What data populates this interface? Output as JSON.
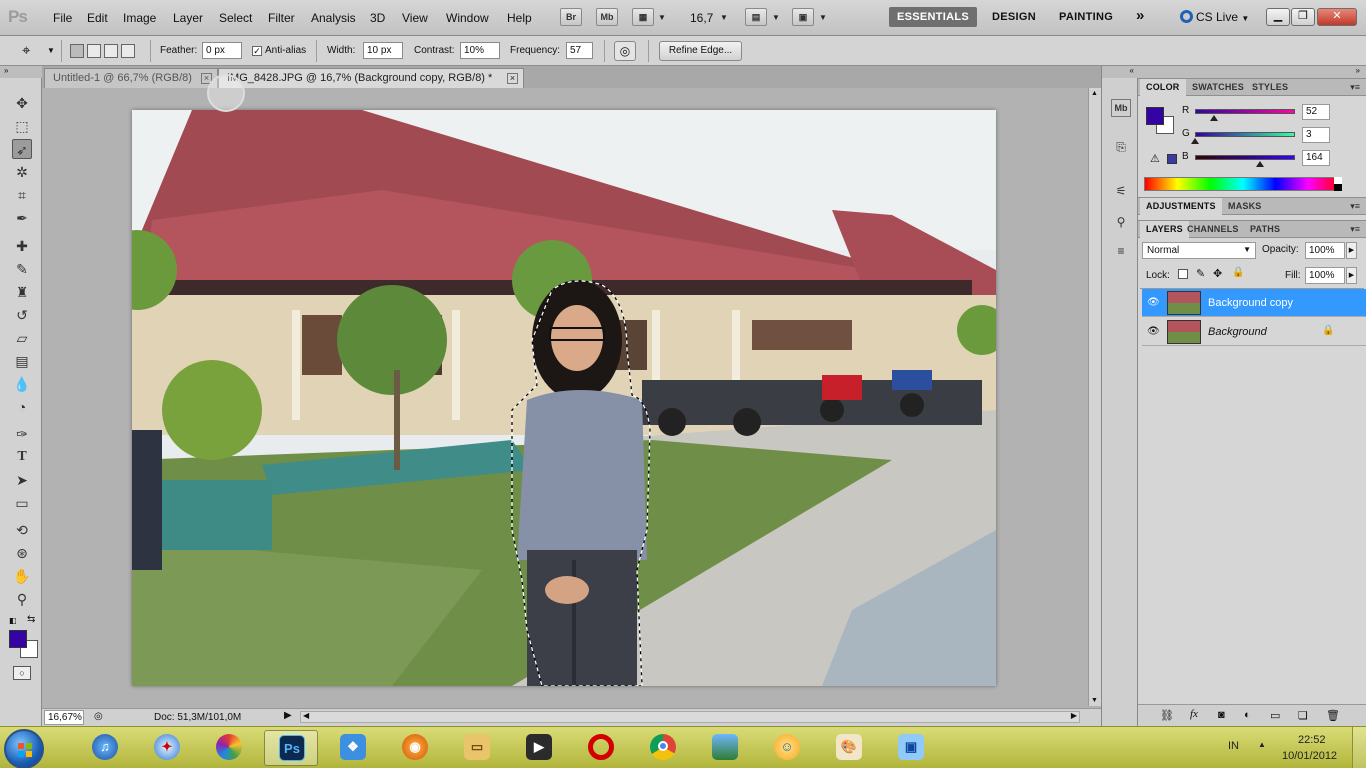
{
  "app": {
    "logo": "Ps",
    "menu": [
      "File",
      "Edit",
      "Image",
      "Layer",
      "Select",
      "Filter",
      "Analysis",
      "3D",
      "View",
      "Window",
      "Help"
    ],
    "bridge_buttons": [
      "Br",
      "Mb"
    ],
    "zoom": "16,7",
    "workspaces": [
      "ESSENTIALS",
      "DESIGN",
      "PAINTING"
    ],
    "more_workspaces": "»",
    "cslive": "CS Live"
  },
  "options": {
    "feather_label": "Feather:",
    "feather_value": "0 px",
    "antialias_label": "Anti-alias",
    "antialias_checked": "✓",
    "width_label": "Width:",
    "width_value": "10 px",
    "contrast_label": "Contrast:",
    "contrast_value": "10%",
    "frequency_label": "Frequency:",
    "frequency_value": "57",
    "refine_label": "Refine Edge..."
  },
  "tools": [
    "move-tool",
    "marquee-tool",
    "magnetic-lasso-tool",
    "quick-selection-tool",
    "crop-tool",
    "eyedropper-tool",
    "healing-brush-tool",
    "brush-tool",
    "clone-stamp-tool",
    "history-brush-tool",
    "eraser-tool",
    "gradient-tool",
    "blur-tool",
    "dodge-tool",
    "pen-tool",
    "type-tool",
    "path-selection-tool",
    "rectangle-tool",
    "3d-rotate-tool",
    "3d-orbit-tool",
    "hand-tool",
    "zoom-tool"
  ],
  "documents": {
    "tabs": [
      {
        "title": "Untitled-1 @ 66,7% (RGB/8)"
      },
      {
        "title": "IMG_8428.JPG @ 16,7% (Background copy, RGB/8) *"
      }
    ],
    "close_glyph": "×"
  },
  "status": {
    "zoom": "16,67%",
    "doc": "Doc: 51,3M/101,0M"
  },
  "color_panel": {
    "tabs": [
      "COLOR",
      "SWATCHES",
      "STYLES"
    ],
    "channels": [
      {
        "label": "R",
        "value": "52"
      },
      {
        "label": "G",
        "value": "3"
      },
      {
        "label": "B",
        "value": "164"
      }
    ],
    "foreground": "#3403a4",
    "background": "#ffffff"
  },
  "adjustments_panel": {
    "tabs": [
      "ADJUSTMENTS",
      "MASKS"
    ]
  },
  "layers_panel": {
    "tabs": [
      "LAYERS",
      "CHANNELS",
      "PATHS"
    ],
    "blend_mode": "Normal",
    "opacity_label": "Opacity:",
    "opacity": "100%",
    "lock_label": "Lock:",
    "fill_label": "Fill:",
    "fill": "100%",
    "layers": [
      {
        "name": "Background copy",
        "selected": true
      },
      {
        "name": "Background",
        "selected": false
      }
    ]
  },
  "taskbar": {
    "apps": [
      "itunes",
      "safari",
      "picasa",
      "photoshop",
      "dropbox",
      "firefox",
      "explorer",
      "media-player",
      "opera",
      "chrome",
      "photo-viewer",
      "messenger",
      "paint",
      "remote"
    ],
    "active_app": "Ps",
    "language": "IN",
    "time": "22:52",
    "date": "10/01/2012"
  }
}
